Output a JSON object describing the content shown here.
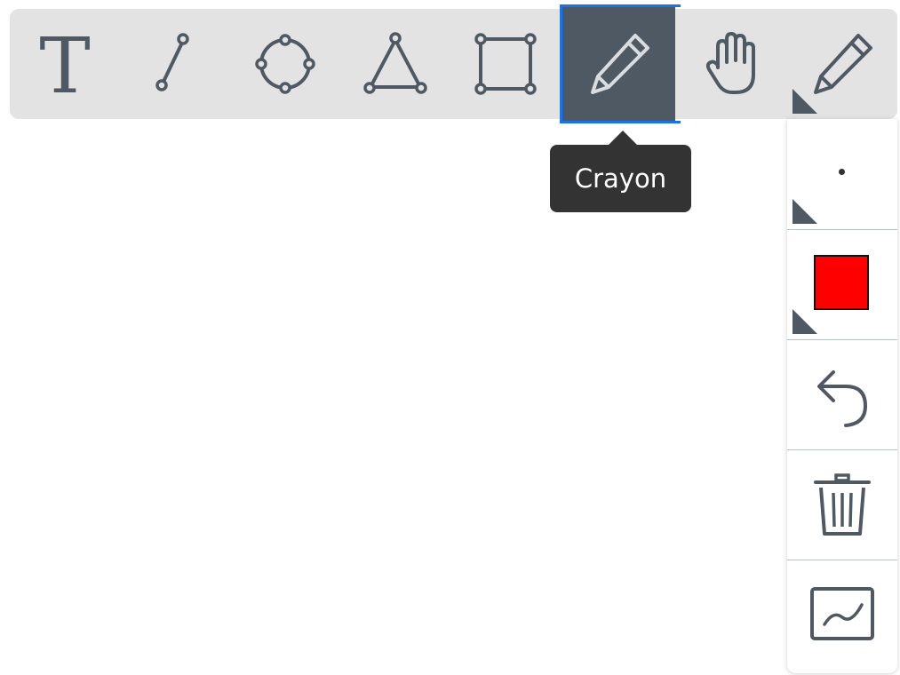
{
  "toolbar": {
    "tools": [
      {
        "name": "text",
        "icon": "text-icon"
      },
      {
        "name": "line",
        "icon": "line-segment-icon"
      },
      {
        "name": "circle",
        "icon": "circle-icon"
      },
      {
        "name": "triangle",
        "icon": "triangle-icon"
      },
      {
        "name": "rectangle",
        "icon": "rectangle-icon"
      },
      {
        "name": "crayon",
        "icon": "pencil-icon",
        "active": true
      },
      {
        "name": "pan",
        "icon": "hand-icon"
      },
      {
        "name": "pen",
        "icon": "pencil-icon"
      }
    ],
    "text_tool_glyph": "T"
  },
  "tooltip": {
    "label": "Crayon"
  },
  "side_panel": {
    "items": [
      {
        "name": "stroke-size",
        "icon": "dot-icon"
      },
      {
        "name": "color",
        "icon": "color-swatch",
        "color": "#ff0000"
      },
      {
        "name": "undo",
        "icon": "undo-icon"
      },
      {
        "name": "delete",
        "icon": "trash-icon"
      },
      {
        "name": "graph",
        "icon": "chart-icon"
      }
    ]
  },
  "colors": {
    "toolbar_bg": "#e3e3e3",
    "icon": "#4f5963",
    "active_bg": "#4f5963",
    "active_border": "#1a73e8",
    "tooltip_bg": "#333333",
    "selected_color": "#ff0000"
  }
}
